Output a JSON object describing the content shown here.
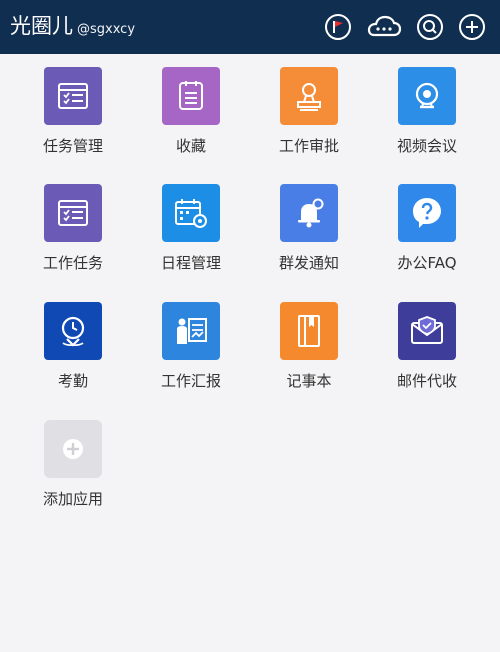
{
  "header": {
    "app_name": "光圈儿",
    "handle": "@sgxxcy",
    "icons": [
      "flag-icon",
      "cloud-icon",
      "search-icon",
      "plus-icon"
    ]
  },
  "apps": [
    {
      "label": "任务管理",
      "icon": "task-list-icon",
      "color": "#6b5bb7"
    },
    {
      "label": "收藏",
      "icon": "favorites-icon",
      "color": "#a566c6"
    },
    {
      "label": "工作审批",
      "icon": "approval-icon",
      "color": "#f58c37"
    },
    {
      "label": "视频会议",
      "icon": "video-conference-icon",
      "color": "#2d8ee7"
    },
    {
      "label": "工作任务",
      "icon": "work-task-icon",
      "color": "#6b5bb7"
    },
    {
      "label": "日程管理",
      "icon": "calendar-icon",
      "color": "#1d8ee5"
    },
    {
      "label": "群发通知",
      "icon": "bell-icon",
      "color": "#4a7ee7"
    },
    {
      "label": "办公FAQ",
      "icon": "faq-icon",
      "color": "#2f88ea"
    },
    {
      "label": "考勤",
      "icon": "attendance-icon",
      "color": "#1049b3"
    },
    {
      "label": "工作汇报",
      "icon": "report-icon",
      "color": "#2d85de"
    },
    {
      "label": "记事本",
      "icon": "notebook-icon",
      "color": "#f5892e"
    },
    {
      "label": "邮件代收",
      "icon": "mail-icon",
      "color": "#3f3d9a"
    },
    {
      "label": "添加应用",
      "icon": "add-app-icon",
      "color": "#e0e0e4"
    }
  ],
  "colors": {
    "header_bg": "#0f2e50",
    "page_bg": "#f4f4f6",
    "flag": "#e53030"
  }
}
